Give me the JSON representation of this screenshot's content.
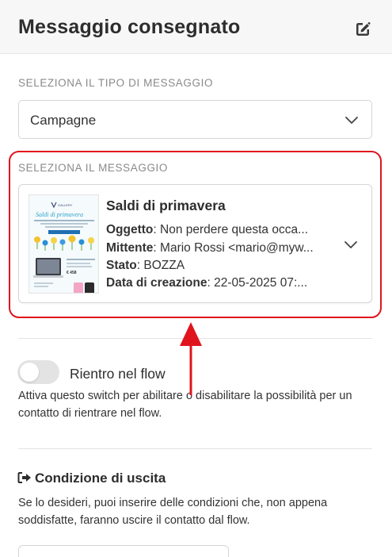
{
  "header": {
    "title": "Messaggio consegnato",
    "edit_icon": "edit-square-pen-icon"
  },
  "message_type": {
    "label": "SELEZIONA IL TIPO DI MESSAGGIO",
    "selected": "Campagne"
  },
  "message": {
    "label": "SELEZIONA IL MESSAGGIO",
    "title": "Saldi di primavera",
    "fields": [
      {
        "key": "Oggetto",
        "value": ": Non perdere questa occa..."
      },
      {
        "key": "Mittente",
        "value": ": Mario Rossi <mario@myw..."
      },
      {
        "key": "Stato",
        "value": ": BOZZA"
      },
      {
        "key": "Data di creazione",
        "value": ": 22-05-2025 07:..."
      }
    ],
    "thumbnail": {
      "brand": "GALLERY",
      "heading": "Saldi di primavera",
      "price": "€ 458"
    }
  },
  "reentry": {
    "label": "Rientro nel flow",
    "enabled": false,
    "description": "Attiva questo switch per abilitare o disabilitare la possibilità per un contatto di rientrare nel flow."
  },
  "exit_condition": {
    "title": "Condizione di uscita",
    "icon": "sign-out-icon",
    "description": "Se lo desideri, puoi inserire delle condizioni che, non appena soddisfatte, faranno uscire il contatto dal flow."
  },
  "colors": {
    "highlight": "#e0141d",
    "annotation_arrow": "#e0141d"
  }
}
